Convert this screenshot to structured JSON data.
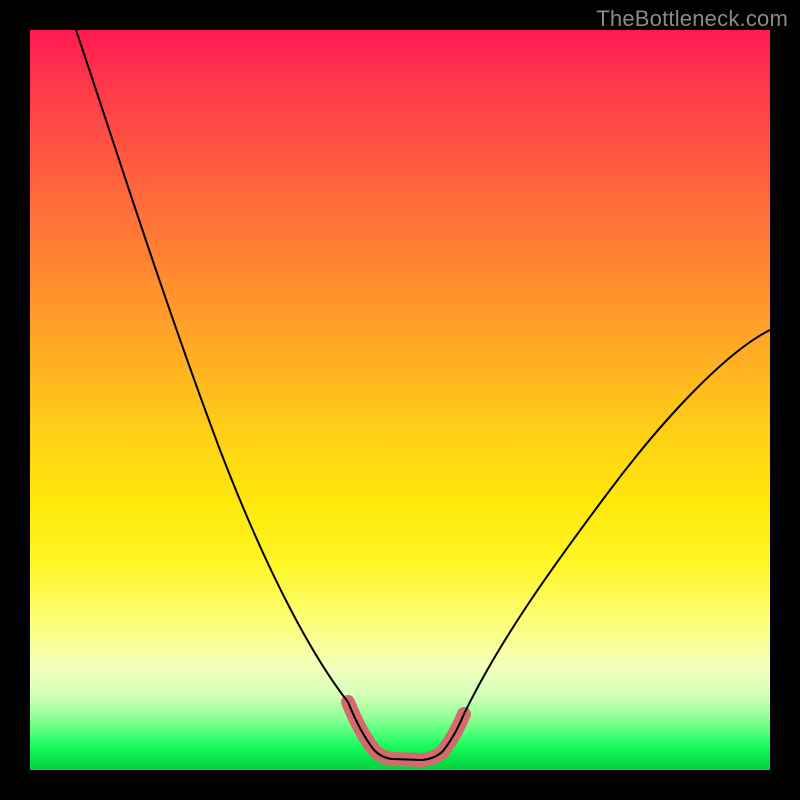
{
  "watermark": "TheBottleneck.com",
  "colors": {
    "background": "#000000",
    "curve_stroke": "#000000",
    "highlight_stroke": "#d36a6d",
    "watermark_text": "#8a8a8a"
  },
  "chart_data": {
    "type": "line",
    "title": "",
    "xlabel": "",
    "ylabel": "",
    "xlim": [
      0,
      100
    ],
    "ylim": [
      0,
      100
    ],
    "grid": false,
    "legend": false,
    "series": [
      {
        "name": "bottleneck-curve",
        "x": [
          6,
          10,
          15,
          20,
          25,
          30,
          35,
          38,
          40,
          42,
          44,
          46,
          48,
          50,
          52,
          56,
          60,
          65,
          70,
          75,
          80,
          85,
          90,
          95,
          100
        ],
        "y": [
          100,
          92,
          82,
          72,
          62,
          51,
          39,
          30,
          24,
          17,
          10,
          5,
          2,
          1,
          1,
          2,
          6,
          13,
          20,
          28,
          35,
          42,
          48,
          54,
          59
        ]
      }
    ],
    "highlight_range_x": [
      44,
      56
    ],
    "annotations": []
  }
}
